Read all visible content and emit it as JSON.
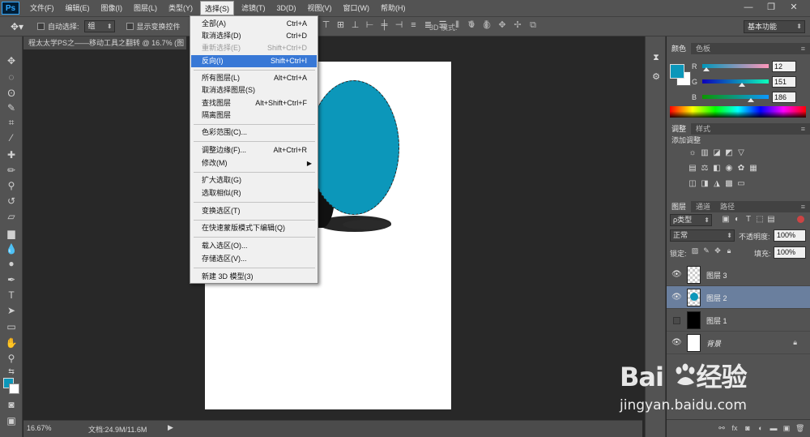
{
  "app": {
    "logo": "Ps"
  },
  "menubar": {
    "items": [
      "文件(F)",
      "编辑(E)",
      "图像(I)",
      "图层(L)",
      "类型(Y)",
      "选择(S)",
      "滤镜(T)",
      "3D(D)",
      "视图(V)",
      "窗口(W)",
      "帮助(H)"
    ],
    "active": "选择(S)"
  },
  "window_controls": {
    "minimize": "—",
    "maximize": "❐",
    "close": "✕"
  },
  "options_bar": {
    "auto_select_label": "自动选择:",
    "auto_select_value": "组",
    "show_transform_label": "显示变换控件",
    "mode3d_label": "3D 模式:",
    "workspace": "基本功能"
  },
  "document": {
    "tab_title": "程太太学PS之——移动工具之翻转 @ 16.7% (图",
    "zoom": "16.67%",
    "doc_info": "文档:24.9M/11.6M",
    "status_arrow": "▶"
  },
  "select_menu": {
    "items": [
      {
        "label": "全部(A)",
        "shortcut": "Ctrl+A",
        "state": "normal"
      },
      {
        "label": "取消选择(D)",
        "shortcut": "Ctrl+D",
        "state": "normal"
      },
      {
        "label": "重新选择(E)",
        "shortcut": "Shift+Ctrl+D",
        "state": "disabled"
      },
      {
        "label": "反向(I)",
        "shortcut": "Shift+Ctrl+I",
        "state": "highlight"
      },
      {
        "label": "所有图层(L)",
        "shortcut": "Alt+Ctrl+A",
        "state": "normal"
      },
      {
        "label": "取消选择图层(S)",
        "shortcut": "",
        "state": "normal"
      },
      {
        "label": "查找图层",
        "shortcut": "Alt+Shift+Ctrl+F",
        "state": "normal"
      },
      {
        "label": "隔离图层",
        "shortcut": "",
        "state": "normal"
      },
      {
        "label": "色彩范围(C)...",
        "shortcut": "",
        "state": "normal"
      },
      {
        "label": "调整边缘(F)...",
        "shortcut": "Alt+Ctrl+R",
        "state": "normal"
      },
      {
        "label": "修改(M)",
        "shortcut": "",
        "state": "normal",
        "submenu_arrow": "▶"
      },
      {
        "label": "扩大选取(G)",
        "shortcut": "",
        "state": "normal"
      },
      {
        "label": "选取相似(R)",
        "shortcut": "",
        "state": "normal"
      },
      {
        "label": "变换选区(T)",
        "shortcut": "",
        "state": "normal"
      },
      {
        "label": "在快速蒙版模式下编辑(Q)",
        "shortcut": "",
        "state": "normal"
      },
      {
        "label": "载入选区(O)...",
        "shortcut": "",
        "state": "normal"
      },
      {
        "label": "存储选区(V)...",
        "shortcut": "",
        "state": "normal"
      },
      {
        "label": "新建 3D 模型(3)",
        "shortcut": "",
        "state": "normal"
      }
    ]
  },
  "color_panel": {
    "tabs": [
      "颜色",
      "色板"
    ],
    "r_label": "R",
    "g_label": "G",
    "b_label": "B",
    "r": "12",
    "g": "151",
    "b": "186",
    "fg_color": "#0c97ba",
    "bg_color": "#ffffff"
  },
  "adjustments_panel": {
    "tabs": [
      "调整",
      "样式"
    ],
    "title": "添加调整"
  },
  "layers_panel": {
    "tabs": [
      "图层",
      "通道",
      "路径"
    ],
    "filter": "ρ类型",
    "blend_mode": "正常",
    "opacity_label": "不透明度:",
    "opacity": "100%",
    "lock_label": "锁定:",
    "fill_label": "填充:",
    "fill": "100%",
    "layers": [
      {
        "name": "图层 3",
        "visible": true,
        "selected": false
      },
      {
        "name": "图层 2",
        "visible": true,
        "selected": true
      },
      {
        "name": "图层 1",
        "visible": false,
        "selected": false
      },
      {
        "name": "背景",
        "visible": true,
        "selected": false,
        "locked": true
      }
    ]
  },
  "watermark": {
    "logo_text": "Bai",
    "logo_suffix": "经验",
    "url": "jingyan.baidu.com"
  }
}
